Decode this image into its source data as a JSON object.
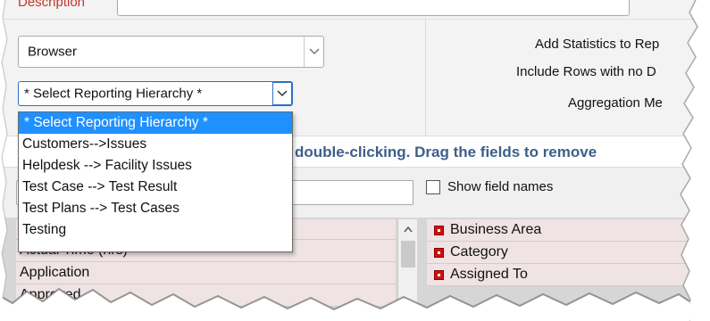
{
  "description": {
    "label": "Description"
  },
  "config": {
    "browser_select": {
      "value": "Browser"
    },
    "hierarchy_select": {
      "value": "* Select Reporting Hierarchy *"
    },
    "options": {
      "add_statistics": "Add Statistics to Rep",
      "include_rows": "Include Rows with no D",
      "aggregation": "Aggregation Me"
    }
  },
  "hierarchy_dropdown": {
    "items": [
      "* Select Reporting Hierarchy *",
      "Customers-->Issues",
      "Helpdesk --> Facility Issues",
      "Test Case --> Test Result",
      "Test Plans --> Test Cases",
      "Testing"
    ],
    "selected_index": 0
  },
  "instructions": {
    "text": "double-clicking. Drag the fields to remove"
  },
  "field_search": {
    "show_field_names_label": "Show field names"
  },
  "available_fields": [
    "Actual Time (hrs)",
    "Application",
    "Approved"
  ],
  "selected_fields": [
    "Business Area",
    "Category",
    "Assigned To"
  ],
  "colors": {
    "selection": "#1e90ff",
    "instruction_text": "#3d5f8a",
    "field_marker": "#cc1111",
    "label_red": "#c0392b"
  },
  "icons": {
    "dropdown_arrow": "chevron-down-icon",
    "field_remove": "red-square-icon",
    "scroll_up": "chevron-up-icon"
  }
}
